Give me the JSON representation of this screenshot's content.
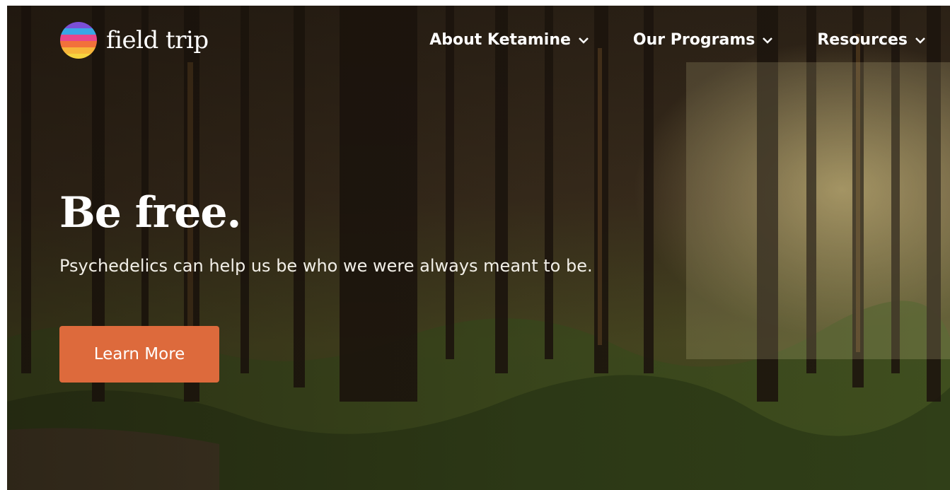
{
  "brand": {
    "name": "field trip",
    "logo_icon": "rainbow-sphere-icon"
  },
  "nav": {
    "items": [
      {
        "label": "About Ketamine",
        "icon": "chevron-down-icon"
      },
      {
        "label": "Our Programs",
        "icon": "chevron-down-icon"
      },
      {
        "label": "Resources",
        "icon": "chevron-down-icon"
      }
    ]
  },
  "hero": {
    "title": "Be free.",
    "subtitle": "Psychedelics can help us be who we were always meant to be.",
    "cta_label": "Learn More",
    "background": "forest-photo"
  },
  "colors": {
    "accent": "#dd6a3c",
    "text": "#ffffff"
  }
}
